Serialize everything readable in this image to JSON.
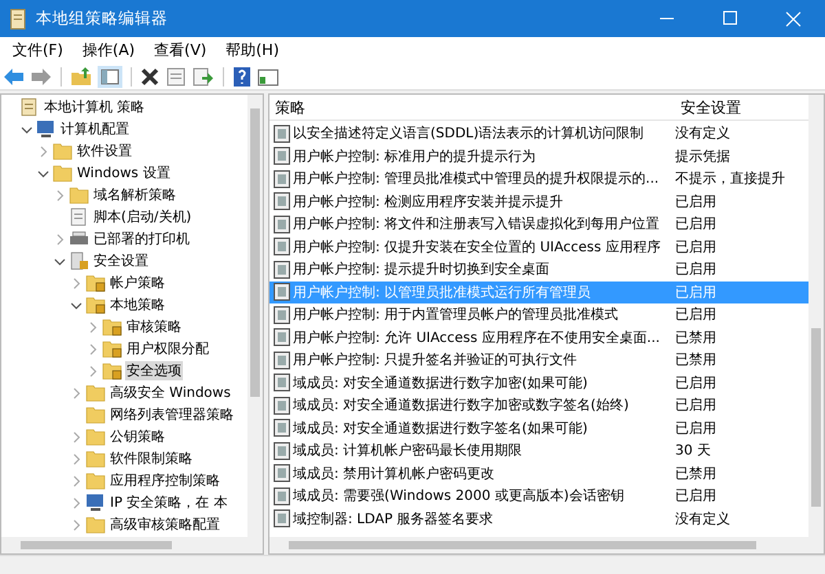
{
  "window": {
    "title": "本地组策略编辑器"
  },
  "menu": [
    "文件(F)",
    "操作(A)",
    "查看(V)",
    "帮助(H)"
  ],
  "tree": [
    {
      "label": "本地计算机 策略",
      "kind": "doc",
      "selected": false,
      "children": [
        {
          "label": "计算机配置",
          "kind": "computer",
          "expanded": true,
          "selected": false,
          "children": [
            {
              "label": "软件设置",
              "kind": "folder",
              "expanded": false,
              "selected": false
            },
            {
              "label": "Windows 设置",
              "kind": "folder",
              "expanded": true,
              "selected": false,
              "children": [
                {
                  "label": "域名解析策略",
                  "kind": "folder",
                  "expanded": false,
                  "selected": false
                },
                {
                  "label": "脚本(启动/关机)",
                  "kind": "script",
                  "selected": false
                },
                {
                  "label": "已部署的打印机",
                  "kind": "printer",
                  "expanded": false,
                  "selected": false
                },
                {
                  "label": "安全设置",
                  "kind": "security",
                  "expanded": true,
                  "selected": false,
                  "children": [
                    {
                      "label": "帐户策略",
                      "kind": "lock-folder",
                      "expanded": false,
                      "selected": false
                    },
                    {
                      "label": "本地策略",
                      "kind": "lock-folder",
                      "expanded": true,
                      "selected": false,
                      "children": [
                        {
                          "label": "审核策略",
                          "kind": "lock-folder",
                          "expanded": false,
                          "selected": false
                        },
                        {
                          "label": "用户权限分配",
                          "kind": "lock-folder",
                          "expanded": false,
                          "selected": false
                        },
                        {
                          "label": "安全选项",
                          "kind": "lock-folder",
                          "expanded": false,
                          "selected": true
                        }
                      ]
                    },
                    {
                      "label": "高级安全 Windows",
                      "kind": "folder",
                      "expanded": false,
                      "selected": false
                    },
                    {
                      "label": "网络列表管理器策略",
                      "kind": "folder",
                      "selected": false
                    },
                    {
                      "label": "公钥策略",
                      "kind": "folder",
                      "expanded": false,
                      "selected": false
                    },
                    {
                      "label": "软件限制策略",
                      "kind": "folder",
                      "expanded": false,
                      "selected": false
                    },
                    {
                      "label": "应用程序控制策略",
                      "kind": "folder",
                      "expanded": false,
                      "selected": false
                    },
                    {
                      "label": "IP 安全策略，在 本",
                      "kind": "computer",
                      "expanded": false,
                      "selected": false
                    },
                    {
                      "label": "高级审核策略配置",
                      "kind": "folder",
                      "expanded": false,
                      "selected": false
                    }
                  ]
                }
              ]
            }
          ]
        }
      ]
    }
  ],
  "table": {
    "columns": [
      "策略",
      "安全设置"
    ],
    "rows": [
      {
        "policy": "以安全描述符定义语言(SDDL)语法表示的计算机访问限制",
        "setting": "没有定义",
        "selected": false
      },
      {
        "policy": "用户帐户控制: 标准用户的提升提示行为",
        "setting": "提示凭据",
        "selected": false
      },
      {
        "policy": "用户帐户控制: 管理员批准模式中管理员的提升权限提示的...",
        "setting": "不提示，直接提升",
        "selected": false
      },
      {
        "policy": "用户帐户控制: 检测应用程序安装并提示提升",
        "setting": "已启用",
        "selected": false
      },
      {
        "policy": "用户帐户控制: 将文件和注册表写入错误虚拟化到每用户位置",
        "setting": "已启用",
        "selected": false
      },
      {
        "policy": "用户帐户控制: 仅提升安装在安全位置的 UIAccess 应用程序",
        "setting": "已启用",
        "selected": false
      },
      {
        "policy": "用户帐户控制: 提示提升时切换到安全桌面",
        "setting": "已启用",
        "selected": false
      },
      {
        "policy": "用户帐户控制: 以管理员批准模式运行所有管理员",
        "setting": "已启用",
        "selected": true
      },
      {
        "policy": "用户帐户控制: 用于内置管理员帐户的管理员批准模式",
        "setting": "已启用",
        "selected": false
      },
      {
        "policy": "用户帐户控制: 允许 UIAccess 应用程序在不使用安全桌面...",
        "setting": "已禁用",
        "selected": false
      },
      {
        "policy": "用户帐户控制: 只提升签名并验证的可执行文件",
        "setting": "已禁用",
        "selected": false
      },
      {
        "policy": "域成员: 对安全通道数据进行数字加密(如果可能)",
        "setting": "已启用",
        "selected": false
      },
      {
        "policy": "域成员: 对安全通道数据进行数字加密或数字签名(始终)",
        "setting": "已启用",
        "selected": false
      },
      {
        "policy": "域成员: 对安全通道数据进行数字签名(如果可能)",
        "setting": "已启用",
        "selected": false
      },
      {
        "policy": "域成员: 计算机帐户密码最长使用期限",
        "setting": "30 天",
        "selected": false
      },
      {
        "policy": "域成员: 禁用计算机帐户密码更改",
        "setting": "已禁用",
        "selected": false
      },
      {
        "policy": "域成员: 需要强(Windows 2000 或更高版本)会话密钥",
        "setting": "已启用",
        "selected": false
      },
      {
        "policy": "域控制器: LDAP 服务器签名要求",
        "setting": "没有定义",
        "selected": false
      }
    ]
  }
}
